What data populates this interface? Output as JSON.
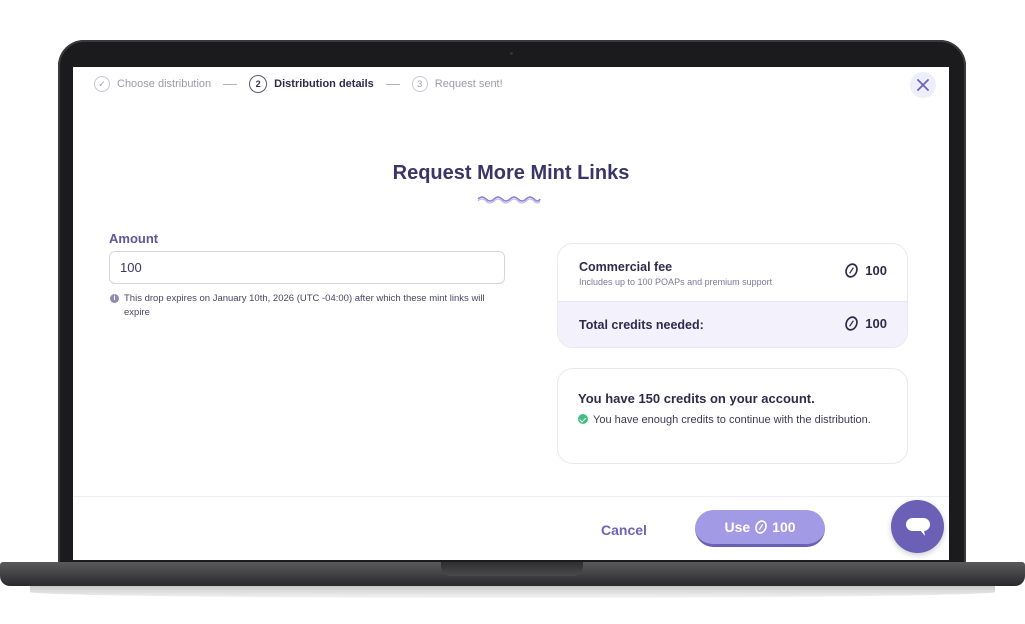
{
  "stepper": {
    "steps": [
      {
        "label": "Choose distribution",
        "marker": "✓",
        "state": "done"
      },
      {
        "label": "Distribution details",
        "marker": "2",
        "state": "active"
      },
      {
        "label": "Request sent!",
        "marker": "3",
        "state": "pending"
      }
    ]
  },
  "modal": {
    "title": "Request More Mint Links",
    "close_icon": "close-icon"
  },
  "form": {
    "amount_label": "Amount",
    "amount_value": "100",
    "hint": "This drop expires on January 10th, 2026 (UTC -04:00) after which these mint links will expire"
  },
  "fee_card": {
    "fee_title": "Commercial fee",
    "fee_subtitle": "Includes up to 100 POAPs and premium support",
    "fee_value": "100",
    "total_label": "Total credits needed:",
    "total_value": "100",
    "coin_icon": "credit-coin-icon"
  },
  "balance_card": {
    "title": "You have 150 credits on your account.",
    "message": "You have enough credits to continue with the distribution."
  },
  "footer": {
    "cancel_label": "Cancel",
    "use_label": "Use",
    "use_value": "100"
  },
  "colors": {
    "accent": "#a39ae6",
    "accent_dark": "#6b60b8",
    "title": "#3b3466",
    "success": "#3fbf7f",
    "chat": "#6b5fb6"
  }
}
